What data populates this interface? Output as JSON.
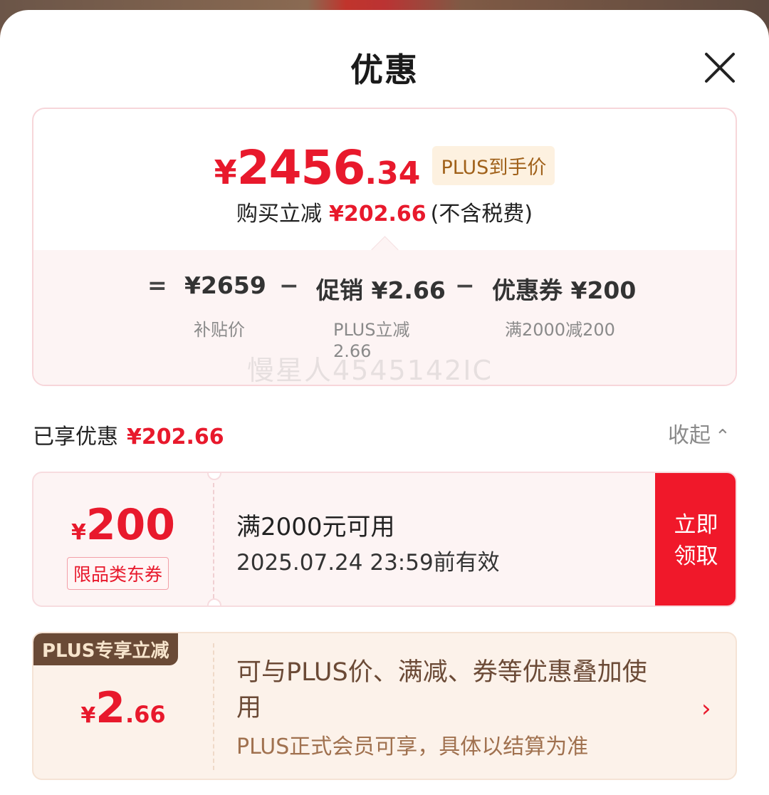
{
  "header": {
    "title": "优惠"
  },
  "price_card": {
    "yen": "¥",
    "price_int": "2456",
    "price_dec": ".34",
    "plus_tag": "PLUS到手价",
    "save_prefix": "购买立减",
    "save_amount": "¥202.66",
    "save_suffix": "(不含税费)",
    "formula": {
      "eq": "=",
      "base": "¥2659",
      "minus": "−",
      "promo": "促销 ¥2.66",
      "coupon": "优惠券 ¥200",
      "base_label": "补贴价",
      "promo_label_1": "PLUS立减",
      "promo_label_2": "2.66",
      "coupon_label": "满2000减200"
    },
    "watermark": "慢星人4545142IC"
  },
  "enjoyed": {
    "label": "已享优惠",
    "amount": "¥202.66",
    "collapse": "收起",
    "collapse_icon": "⌃"
  },
  "coupon": {
    "yen": "¥",
    "amount": "200",
    "tag": "限品类东券",
    "condition": "满2000元可用",
    "validity": "2025.07.24 23:59前有效",
    "button_line1": "立即",
    "button_line2": "领取"
  },
  "plus_offer": {
    "badge": "PLUS专享立减",
    "yen": "¥",
    "amount_int": "2",
    "amount_dec": ".66",
    "description": "可与PLUS价、满减、券等优惠叠加使用",
    "note": "PLUS正式会员可享，具体以结算为准",
    "arrow": "›"
  },
  "colors": {
    "accent": "#e8192c",
    "plus_brown": "#6a4a36",
    "button_red": "#f0182a"
  }
}
